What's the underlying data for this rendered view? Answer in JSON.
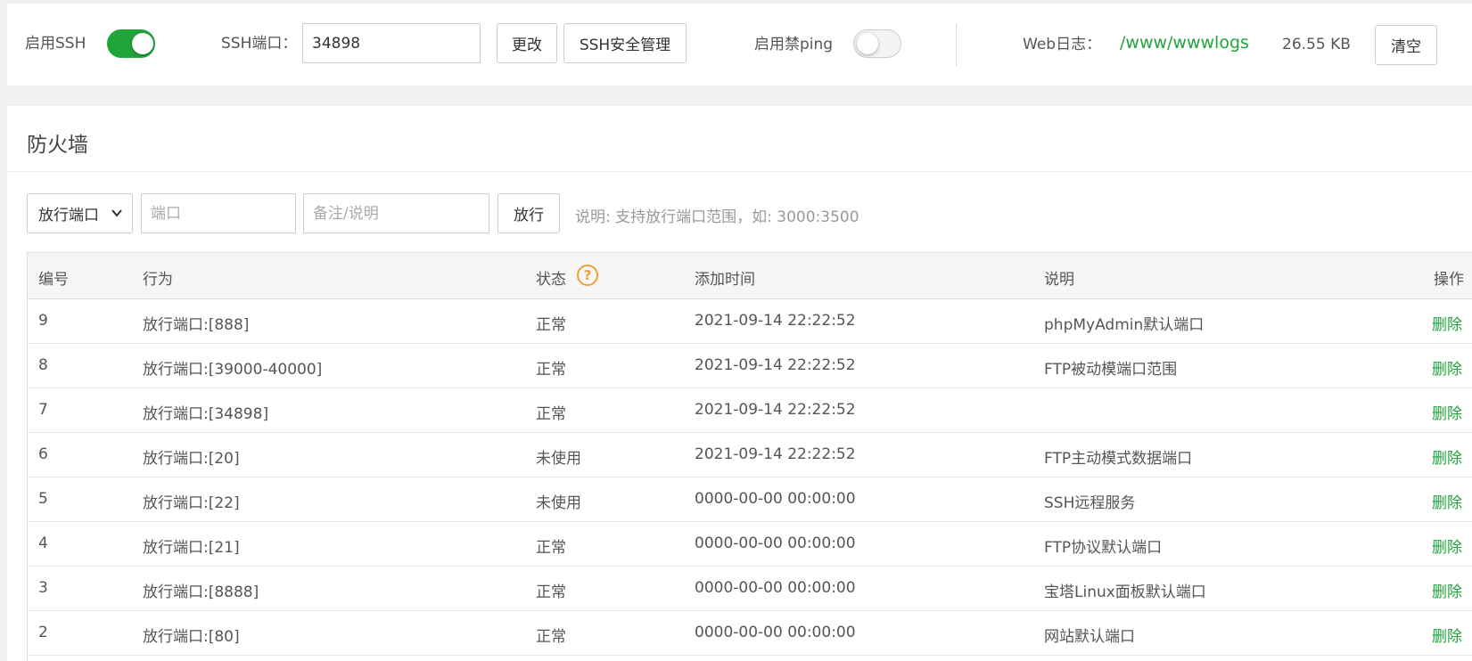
{
  "topbar": {
    "ssh_label": "启用SSH",
    "ssh_enabled": true,
    "ssh_port_label": "SSH端口：",
    "ssh_port_value": "34898",
    "change_button": "更改",
    "ssh_security_button": "SSH安全管理",
    "ping_label": "启用禁ping",
    "ping_enabled": false,
    "weblog_label": "Web日志：",
    "weblog_path": "/www/wwwlogs",
    "weblog_size": "26.55 KB",
    "clear_button": "清空"
  },
  "firewall": {
    "title": "防火墙",
    "type_select": "放行端口",
    "port_placeholder": "端口",
    "note_placeholder": "备注/说明",
    "allow_button": "放行",
    "hint": "说明: 支持放行端口范围，如: 3000:3500"
  },
  "table": {
    "headers": {
      "id": "编号",
      "action": "行为",
      "status": "状态",
      "status_help": "?",
      "added": "添加时间",
      "note": "说明",
      "op": "操作"
    },
    "rows": [
      {
        "id": "9",
        "action": "放行端口:[888]",
        "status": "正常",
        "added": "2021-09-14 22:22:52",
        "note": "phpMyAdmin默认端口",
        "op": "删除"
      },
      {
        "id": "8",
        "action": "放行端口:[39000-40000]",
        "status": "正常",
        "added": "2021-09-14 22:22:52",
        "note": "FTP被动模端口范围",
        "op": "删除"
      },
      {
        "id": "7",
        "action": "放行端口:[34898]",
        "status": "正常",
        "added": "2021-09-14 22:22:52",
        "note": "",
        "op": "删除"
      },
      {
        "id": "6",
        "action": "放行端口:[20]",
        "status": "未使用",
        "added": "2021-09-14 22:22:52",
        "note": "FTP主动模式数据端口",
        "op": "删除"
      },
      {
        "id": "5",
        "action": "放行端口:[22]",
        "status": "未使用",
        "added": "0000-00-00 00:00:00",
        "note": "SSH远程服务",
        "op": "删除"
      },
      {
        "id": "4",
        "action": "放行端口:[21]",
        "status": "正常",
        "added": "0000-00-00 00:00:00",
        "note": "FTP协议默认端口",
        "op": "删除"
      },
      {
        "id": "3",
        "action": "放行端口:[8888]",
        "status": "正常",
        "added": "0000-00-00 00:00:00",
        "note": "宝塔Linux面板默认端口",
        "op": "删除"
      },
      {
        "id": "2",
        "action": "放行端口:[80]",
        "status": "正常",
        "added": "0000-00-00 00:00:00",
        "note": "网站默认端口",
        "op": "删除"
      }
    ]
  },
  "colors": {
    "accent_green": "#20a53a",
    "help_orange": "#f0a030"
  }
}
